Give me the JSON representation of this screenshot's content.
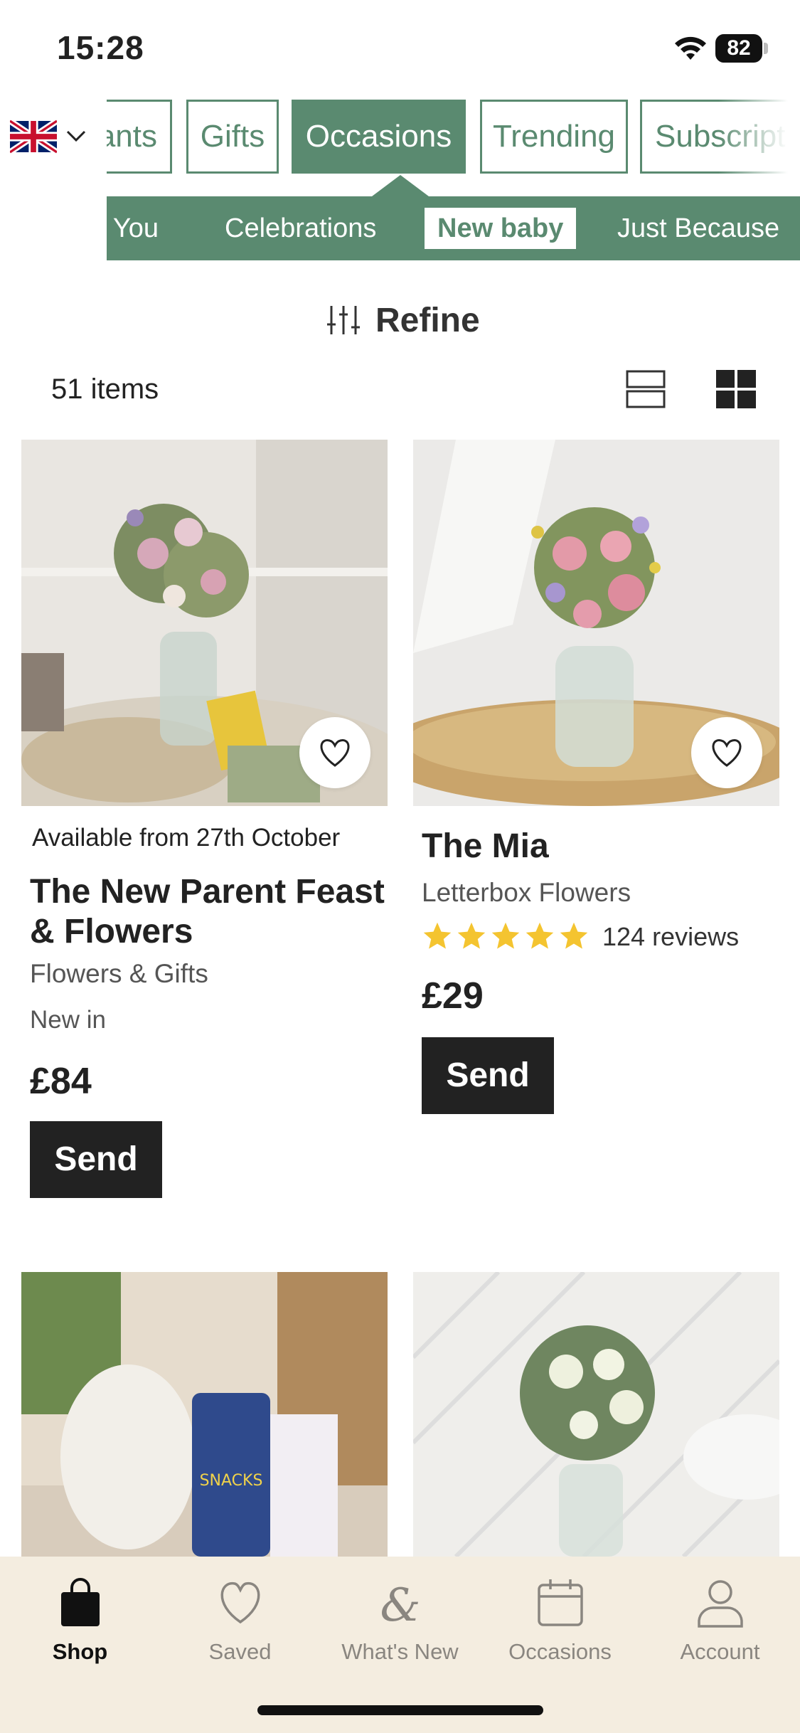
{
  "status_bar": {
    "time": "15:28",
    "battery": "82"
  },
  "header": {
    "tabs": [
      {
        "label": "ants",
        "active": false
      },
      {
        "label": "Gifts",
        "active": false
      },
      {
        "label": "Occasions",
        "active": true
      },
      {
        "label": "Trending",
        "active": false
      },
      {
        "label": "Subscripti",
        "active": false
      }
    ],
    "subcategories": [
      {
        "label": "k You",
        "active": false
      },
      {
        "label": "Celebrations",
        "active": false
      },
      {
        "label": "New baby",
        "active": true
      },
      {
        "label": "Just Because",
        "active": false
      }
    ],
    "accent_color": "#5a8a70"
  },
  "toolbar": {
    "refine_label": "Refine",
    "item_count": "51 items"
  },
  "products": [
    {
      "availability": "Available from 27th October",
      "name": "The New Parent Feast & Flowers",
      "category": "Flowers & Gifts",
      "badge": "New in",
      "price": "£84",
      "send_label": "Send"
    },
    {
      "name": "The Mia",
      "category": "Letterbox Flowers",
      "rating": 5,
      "reviews": "124 reviews",
      "price": "£29",
      "send_label": "Send"
    }
  ],
  "bottom_nav": {
    "items": [
      {
        "label": "Shop",
        "icon": "shopping-bag-icon",
        "active": true
      },
      {
        "label": "Saved",
        "icon": "heart-icon",
        "active": false
      },
      {
        "label": "What's New",
        "icon": "ampersand-icon",
        "active": false
      },
      {
        "label": "Occasions",
        "icon": "calendar-icon",
        "active": false
      },
      {
        "label": "Account",
        "icon": "person-icon",
        "active": false
      }
    ]
  }
}
